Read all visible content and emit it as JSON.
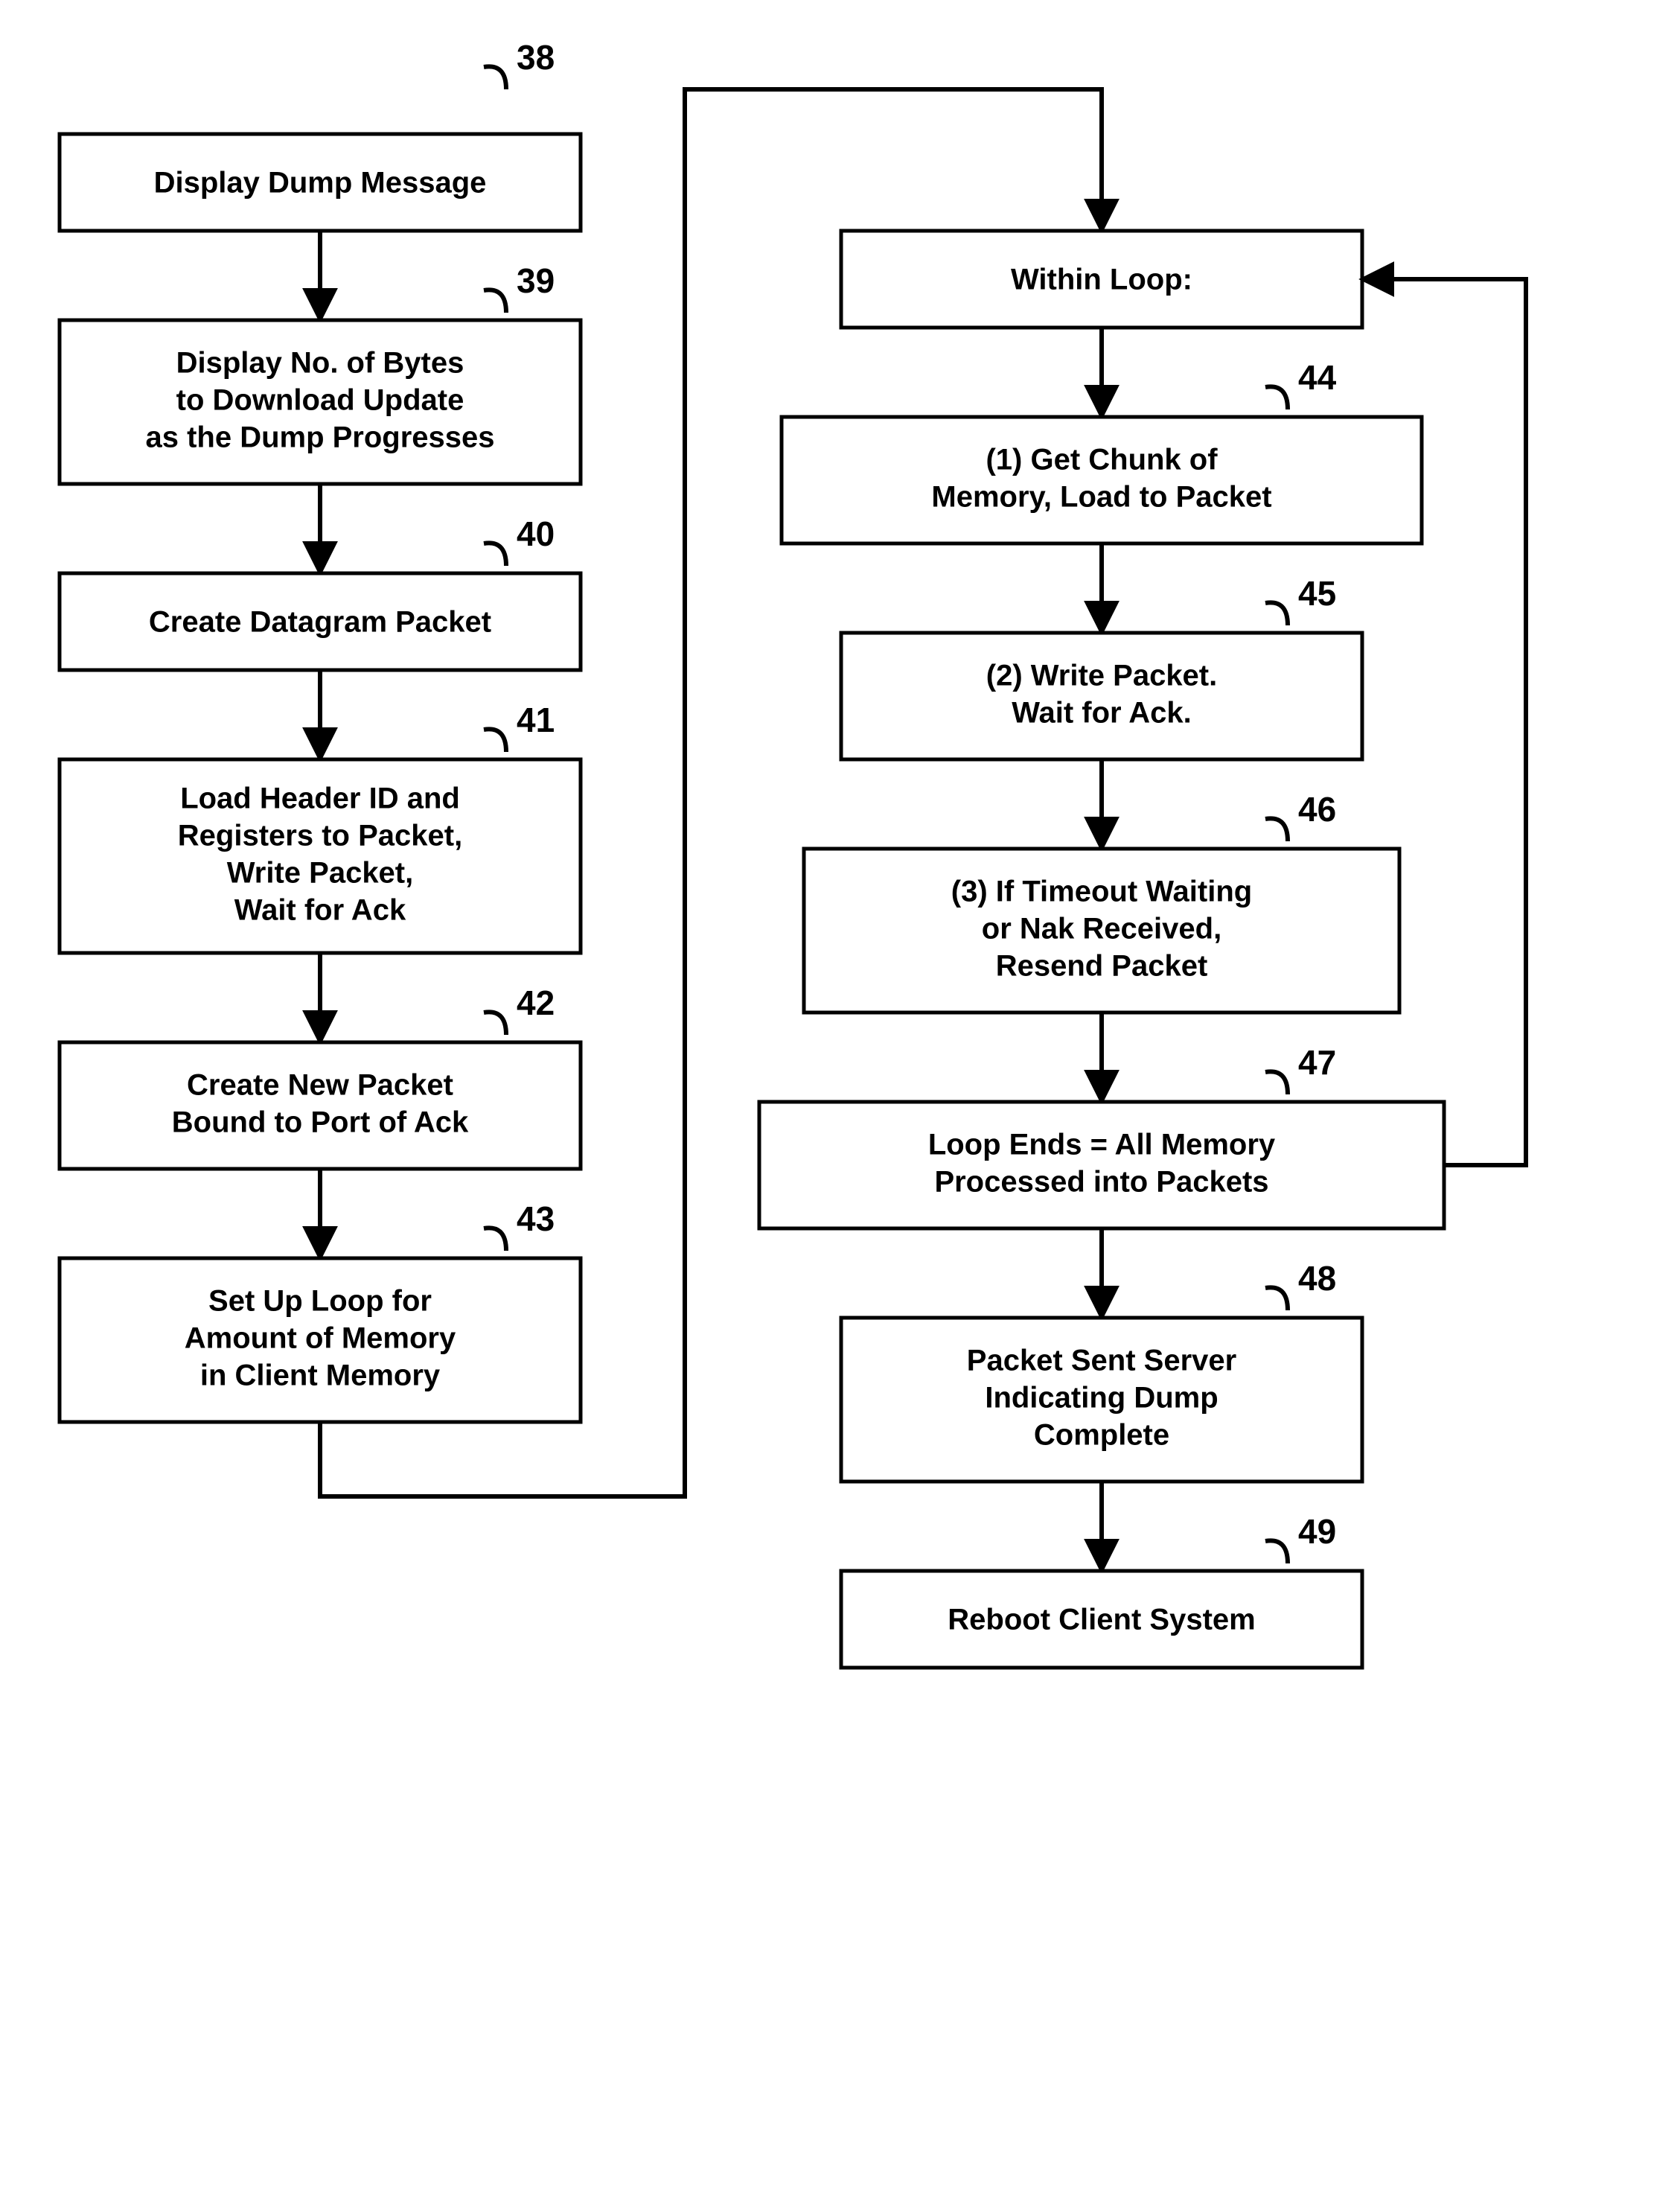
{
  "chart_data": {
    "type": "flowchart",
    "nodes": [
      {
        "id": "38",
        "text": "Display Dump Message"
      },
      {
        "id": "39",
        "text": "Display No. of Bytes to Download Update as the Dump Progresses"
      },
      {
        "id": "40",
        "text": "Create Datagram Packet"
      },
      {
        "id": "41",
        "text": "Load Header ID and Registers to Packet, Write Packet, Wait for Ack"
      },
      {
        "id": "42",
        "text": "Create New Packet Bound to Port of Ack"
      },
      {
        "id": "43",
        "text": "Set Up Loop for Amount of Memory in Client Memory"
      },
      {
        "id": "within",
        "text": "Within Loop:"
      },
      {
        "id": "44",
        "text": "(1) Get Chunk of Memory, Load to Packet"
      },
      {
        "id": "45",
        "text": "(2) Write Packet. Wait for Ack."
      },
      {
        "id": "46",
        "text": "(3) If Timeout Waiting or Nak Received, Resend Packet"
      },
      {
        "id": "47",
        "text": "Loop Ends = All Memory Processed into Packets"
      },
      {
        "id": "48",
        "text": "Packet Sent Server Indicating Dump Complete"
      },
      {
        "id": "49",
        "text": "Reboot Client System"
      }
    ],
    "edges": [
      {
        "from": "38",
        "to": "39"
      },
      {
        "from": "39",
        "to": "40"
      },
      {
        "from": "40",
        "to": "41"
      },
      {
        "from": "41",
        "to": "42"
      },
      {
        "from": "42",
        "to": "43"
      },
      {
        "from": "43",
        "to": "within"
      },
      {
        "from": "within",
        "to": "44"
      },
      {
        "from": "44",
        "to": "45"
      },
      {
        "from": "45",
        "to": "46"
      },
      {
        "from": "46",
        "to": "47"
      },
      {
        "from": "47",
        "to": "within",
        "type": "loop-back"
      },
      {
        "from": "47",
        "to": "48"
      },
      {
        "from": "48",
        "to": "49"
      }
    ]
  },
  "boxes": {
    "b38": {
      "label": "38",
      "l1": "Display Dump Message"
    },
    "b39": {
      "label": "39",
      "l1": "Display No. of Bytes",
      "l2": "to Download Update",
      "l3": "as the Dump Progresses"
    },
    "b40": {
      "label": "40",
      "l1": "Create Datagram Packet"
    },
    "b41": {
      "label": "41",
      "l1": "Load Header ID and",
      "l2": "Registers to Packet,",
      "l3": "Write Packet,",
      "l4": "Wait for Ack"
    },
    "b42": {
      "label": "42",
      "l1": "Create New Packet",
      "l2": "Bound to Port of Ack"
    },
    "bWL": {
      "l1": "Within Loop:"
    },
    "b43": {
      "label": "43",
      "l1": "Set Up Loop for",
      "l2": "Amount of Memory",
      "l3": "in Client Memory"
    },
    "b44": {
      "label": "44",
      "l1": "(1) Get Chunk of",
      "l2": "Memory, Load to Packet"
    },
    "b45": {
      "label": "45",
      "l1": "(2) Write Packet.",
      "l2": "Wait for Ack."
    },
    "b46": {
      "label": "46",
      "l1": "(3) If Timeout Waiting",
      "l2": "or Nak Received,",
      "l3": "Resend Packet"
    },
    "b47": {
      "label": "47",
      "l1": "Loop Ends = All Memory",
      "l2": "Processed into Packets"
    },
    "b48": {
      "label": "48",
      "l1": "Packet Sent Server",
      "l2": "Indicating Dump",
      "l3": "Complete"
    },
    "b49": {
      "label": "49",
      "l1": "Reboot Client System"
    }
  }
}
